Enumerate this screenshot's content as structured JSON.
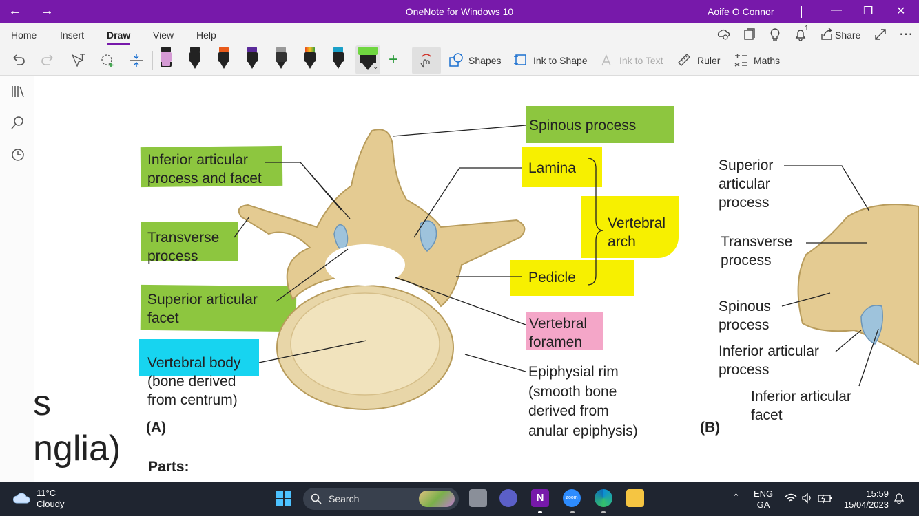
{
  "window": {
    "title": "OneNote for Windows 10",
    "user": "Aoife O Connor",
    "back_icon": "←",
    "forward_icon": "→",
    "minimize_icon": "—",
    "restore_icon": "❐",
    "close_icon": "✕"
  },
  "menu": {
    "tabs": [
      "Home",
      "Insert",
      "Draw",
      "View",
      "Help"
    ],
    "active_tab": "Draw",
    "share_label": "Share",
    "notification_badge": "1"
  },
  "toolbar": {
    "shapes_label": "Shapes",
    "ink_to_shape_label": "Ink to Shape",
    "ink_to_text_label": "Ink to Text",
    "ruler_label": "Ruler",
    "maths_label": "Maths",
    "pen_colors": [
      "#d59ad4",
      "#222222",
      "#e85a1a",
      "#5a2a9a",
      "#777777",
      "#e84a1a",
      "#1aa0c8"
    ],
    "highlighter_color": "#6fd640"
  },
  "diagram": {
    "labels_a": {
      "inferior_articular": "Inferior articular\nprocess and facet",
      "transverse_process": "Transverse\nprocess",
      "superior_articular_facet": "Superior articular\nfacet",
      "vertebral_body": "Vertebral body\n(bone derived\nfrom centrum)",
      "spinous_process": "Spinous process",
      "lamina": "Lamina",
      "vertebral_arch": "Vertebral\narch",
      "pedicle": "Pedicle",
      "vertebral_foramen": "Vertebral\nforamen",
      "epiphysial_rim": "Epiphysial rim\n(smooth bone\nderived from\nanular epiphysis)",
      "figure_tag": "(A)",
      "parts": "Parts:"
    },
    "labels_b": {
      "superior_articular_process": "Superior\narticular\nprocess",
      "transverse_process": "Transverse\nprocess",
      "spinous_process": "Spinous\nprocess",
      "inferior_articular_process": "Inferior articular\nprocess",
      "inferior_articular_facet": "Inferior articular\nfacet",
      "figure_tag": "(B)"
    },
    "partial_text": [
      "s",
      "nglia)"
    ],
    "highlight_colors": {
      "green": "#8dc63f",
      "yellow": "#f7f000",
      "pink": "#f4a6c8",
      "cyan": "#17d4f0"
    }
  },
  "taskbar": {
    "temperature": "11°C",
    "weather": "Cloudy",
    "search_placeholder": "Search",
    "language_1": "ENG",
    "language_2": "GA",
    "time": "15:59",
    "date": "15/04/2023"
  }
}
